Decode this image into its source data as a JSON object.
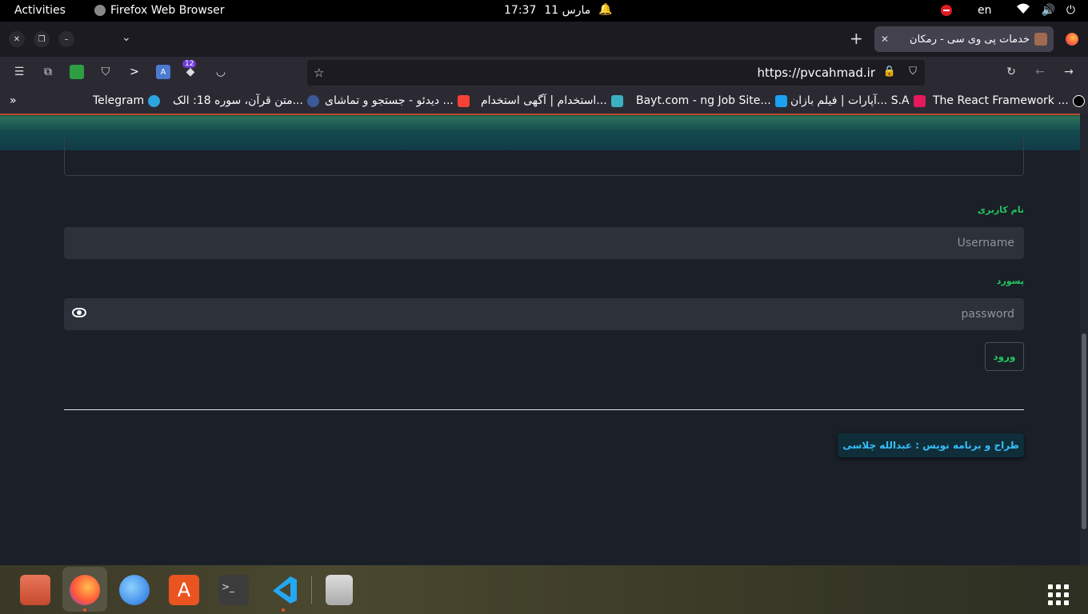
{
  "topbar": {
    "activities": "Activities",
    "app_name": "Firefox Web Browser",
    "time": "17:37",
    "date": "مارس 11",
    "language": "en"
  },
  "browser": {
    "tab_title": "خدمات پی وی سی - رمکان",
    "url": "https://pvcahmad.ir",
    "extension_badge": "12"
  },
  "bookmarks": [
    {
      "label": "The React Framework ...",
      "color": "#000000"
    },
    {
      "label": "آپارات | فیلم بازان... S.A",
      "color": "#e6195a"
    },
    {
      "label": "Bayt.com - ng Job Site...",
      "color": "#1da1f2"
    },
    {
      "label": "استخدام | آگهی استخدام...",
      "color": "#3ab0c3"
    },
    {
      "label": "دیدئو - جستجو و تماشای ...",
      "color": "#f44336"
    },
    {
      "label": "متن قرآن، سوره 18: الک...",
      "color": "#3b5998"
    },
    {
      "label": "Telegram",
      "color": "#2ca5e0"
    }
  ],
  "form": {
    "username_label": "نام کاربری",
    "username_placeholder": "Username",
    "password_label": "پسورد",
    "password_placeholder": "password",
    "login_button": "ورود"
  },
  "footer": {
    "credit": "طراح و برنامه نویس : عبدالله چلاسی"
  },
  "colors": {
    "accent_green": "#22c55e",
    "credit_blue": "#38bdf8"
  }
}
